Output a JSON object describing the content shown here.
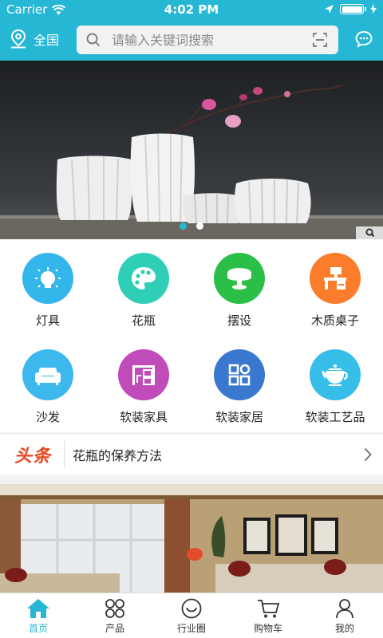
{
  "status_bar": {
    "carrier": "Carrier",
    "time": "4:02 PM"
  },
  "header": {
    "location": "全国",
    "search_placeholder": "请输入关键词搜索"
  },
  "banner": {
    "slide_count": 2,
    "active_slide": 1
  },
  "categories": [
    {
      "label": "灯具",
      "icon": "bulb-icon",
      "color": "#33b6ea"
    },
    {
      "label": "花瓶",
      "icon": "palette-icon",
      "color": "#2ecfb6"
    },
    {
      "label": "摆设",
      "icon": "table-icon",
      "color": "#2bbf47"
    },
    {
      "label": "木质桌子",
      "icon": "desk-icon",
      "color": "#fb7d2c"
    },
    {
      "label": "沙发",
      "icon": "sofa-icon",
      "color": "#3db8ec"
    },
    {
      "label": "软装家具",
      "icon": "furniture-icon",
      "color": "#c04cba"
    },
    {
      "label": "软装家居",
      "icon": "grid-icon",
      "color": "#3a78d0"
    },
    {
      "label": "软装工艺品",
      "icon": "teapot-icon",
      "color": "#36bde8"
    }
  ],
  "headline": {
    "tag": "头条",
    "text": "花瓶的保养方法"
  },
  "tabbar": [
    {
      "label": "首页",
      "icon": "home-icon",
      "active": true
    },
    {
      "label": "产品",
      "icon": "products-icon",
      "active": false
    },
    {
      "label": "行业圈",
      "icon": "circle-icon",
      "active": false
    },
    {
      "label": "购物车",
      "icon": "cart-icon",
      "active": false
    },
    {
      "label": "我的",
      "icon": "user-icon",
      "active": false
    }
  ],
  "colors": {
    "accent": "#26b7d4",
    "headline_tag": "#e8461f"
  }
}
